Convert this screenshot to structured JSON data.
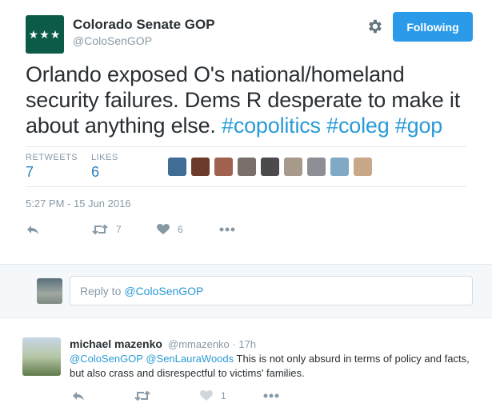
{
  "author": {
    "name": "Colorado Senate GOP",
    "handle": "@ColoSenGOP",
    "avatar_text": "★★★"
  },
  "header": {
    "follow_label": "Following",
    "settings_icon": "gear-icon"
  },
  "tweet": {
    "text_plain": "Orlando exposed O's national/homeland security failures. Dems R desperate to make it about anything else.",
    "hashtags": "#copolitics #coleg #gop",
    "timestamp": "5:27 PM - 15 Jun 2016"
  },
  "stats": {
    "retweets_label": "RETWEETS",
    "retweets_value": "7",
    "likes_label": "LIKES",
    "likes_value": "6",
    "liker_colors": [
      "#3f6d96",
      "#6d3b2c",
      "#a0624f",
      "#7a6f6a",
      "#4c4a4c",
      "#a89a8a",
      "#8e8f94",
      "#7fa9c4",
      "#c7a98a"
    ]
  },
  "actions": {
    "reply_icon": "reply-icon",
    "retweet_icon": "retweet-icon",
    "retweet_count": "7",
    "like_icon": "heart-icon",
    "like_count": "6",
    "more_icon": "more-icon"
  },
  "reply_composer": {
    "placeholder_prefix": "Reply to",
    "placeholder_handle": "@ColoSenGOP"
  },
  "reply": {
    "name": "michael mazenko",
    "handle": "@mmazenko",
    "time": "· 17h",
    "mentions": "@ColoSenGOP @SenLauraWoods",
    "text": "This is not only absurd in terms of policy and facts, but also crass and disrespectful to victims' families.",
    "like_count": "1"
  },
  "colors": {
    "accent": "#2b9be9",
    "link": "#2a9bd6",
    "muted": "#8899a6"
  }
}
